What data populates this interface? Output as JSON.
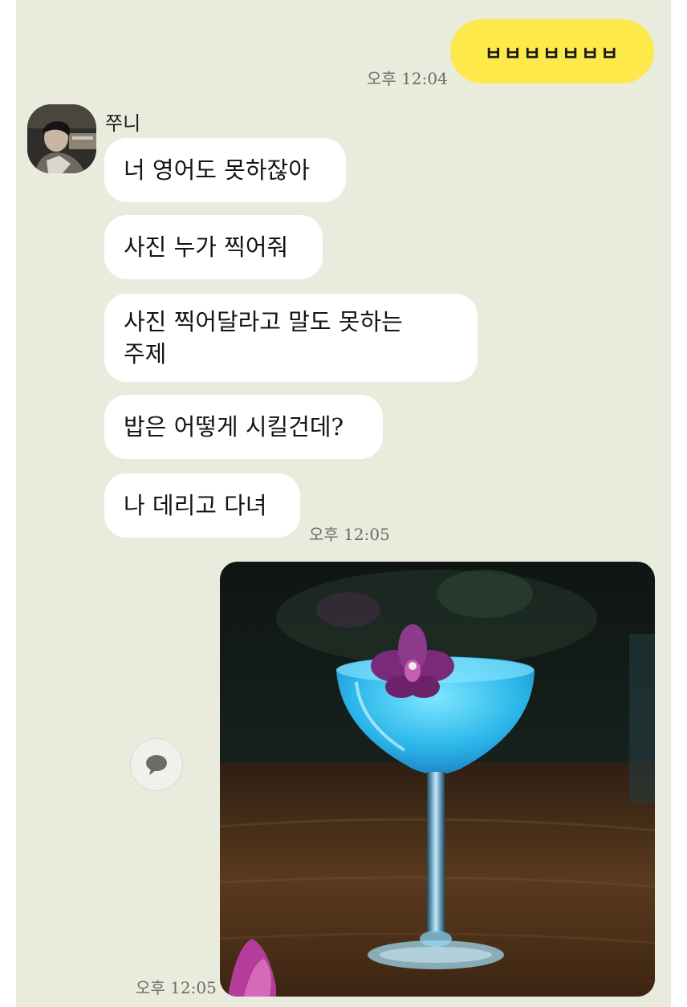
{
  "messages": {
    "me_1": {
      "text": "ㅂㅂㅂㅂㅂㅂㅂ",
      "time": "오후 12:04"
    },
    "friend": {
      "sender": "쭈니",
      "bubbles": [
        "너 영어도 못하잖아",
        "사진 누가 찍어줘",
        "사진 찍어달라고 말도 못하는\n주제",
        "밥은 어떻게 시킬건데?",
        "나 데리고 다녀"
      ],
      "time": "오후 12:05"
    },
    "me_2": {
      "time": "오후 12:05"
    }
  },
  "icons": {
    "share": "speech-bubble-icon"
  },
  "colors": {
    "background": "#e9ecdd",
    "my_bubble": "#fde94a",
    "friend_bubble": "#ffffff"
  }
}
